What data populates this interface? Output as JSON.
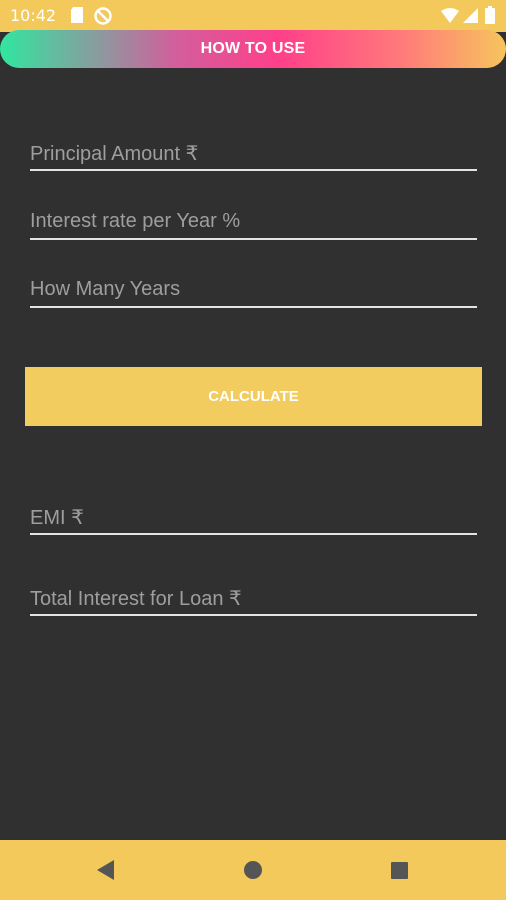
{
  "status_bar": {
    "time": "10:42",
    "icons": [
      "sd-card-icon",
      "do-not-disturb-icon",
      "wifi-icon",
      "signal-icon",
      "battery-icon"
    ]
  },
  "howto": {
    "label": "HOW TO USE"
  },
  "form": {
    "principal_placeholder": "Principal Amount ₹",
    "interest_placeholder": "Interest rate per Year %",
    "years_placeholder": "How Many Years"
  },
  "calculate_button": {
    "label": "CALCULATE"
  },
  "results": {
    "emi_placeholder": "EMI ₹",
    "total_interest_placeholder": "Total Interest for Loan ₹"
  },
  "nav_bar": {
    "buttons": [
      "back-icon",
      "home-icon",
      "recents-icon"
    ]
  },
  "colors": {
    "accent": "#f2c95a",
    "background": "#303030",
    "placeholder": "#9e9e9e"
  }
}
